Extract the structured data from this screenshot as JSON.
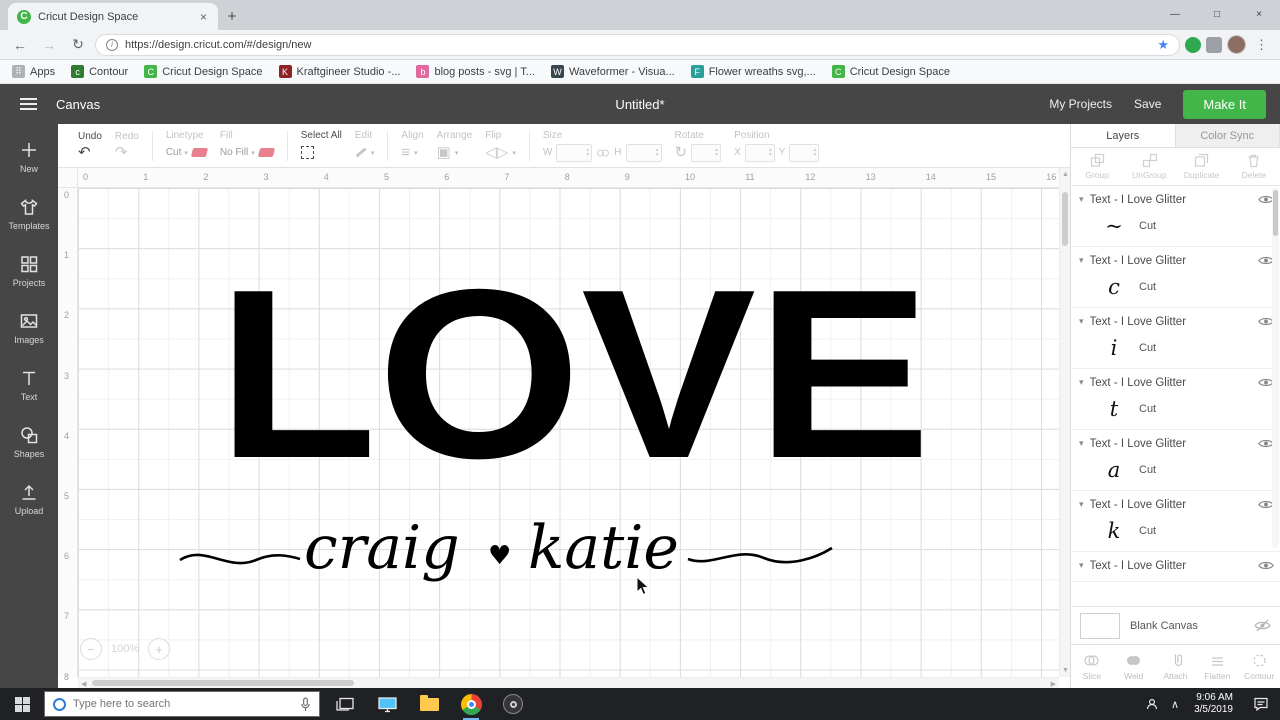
{
  "colors": {
    "accent_green": "#43b649",
    "app_dark": "#464646",
    "swatch_pink": "#e8808d",
    "artwork_black": "#000000"
  },
  "browser": {
    "tab_title": "Cricut Design Space",
    "favicon_letter": "C",
    "close_tab": "×",
    "new_tab": "+",
    "win_min": "—",
    "win_max": "□",
    "win_close": "×",
    "back": "←",
    "forward": "→",
    "reload": "↻",
    "star": "★",
    "menu": "⋮",
    "url": "https://design.cricut.com/#/design/new",
    "bookmarks": [
      {
        "label": "Apps",
        "letter": "⠿",
        "color": "#aeb1b6"
      },
      {
        "label": "Contour",
        "letter": "c",
        "color": "#2e7d32"
      },
      {
        "label": "Cricut Design Space",
        "letter": "C",
        "color": "#43b649"
      },
      {
        "label": "Kraftgineer Studio -...",
        "letter": "K",
        "color": "#8e2323"
      },
      {
        "label": "blog posts - svg | T...",
        "letter": "b",
        "color": "#e06a9f"
      },
      {
        "label": "Waveformer - Visua...",
        "letter": "W",
        "color": "#37474f"
      },
      {
        "label": "Flower wreaths svg,...",
        "letter": "F",
        "color": "#2aa198"
      },
      {
        "label": "Cricut Design Space",
        "letter": "C",
        "color": "#43b649"
      }
    ]
  },
  "header": {
    "view": "Canvas",
    "title": "Untitled*",
    "my_projects": "My Projects",
    "save": "Save",
    "make_it": "Make It"
  },
  "toolbar": {
    "undo": "Undo",
    "redo": "Redo",
    "undo_icon": "↶",
    "redo_icon": "↷",
    "linetype_label": "Linetype",
    "linetype_value": "Cut",
    "fill_label": "Fill",
    "fill_value": "No Fill",
    "select_all": "Select All",
    "edit": "Edit",
    "align": "Align",
    "arrange": "Arrange",
    "flip": "Flip",
    "size_label": "Size",
    "w": "W",
    "h": "H",
    "rotate": "Rotate",
    "rotate_icon": "↻",
    "position_label": "Position",
    "x": "X",
    "y": "Y",
    "caret": "▾"
  },
  "sidebar": {
    "items": [
      {
        "label": "New"
      },
      {
        "label": "Templates"
      },
      {
        "label": "Projects"
      },
      {
        "label": "Images"
      },
      {
        "label": "Text"
      },
      {
        "label": "Shapes"
      },
      {
        "label": "Upload"
      }
    ]
  },
  "canvas": {
    "ruler_h": [
      "0",
      "1",
      "2",
      "3",
      "4",
      "5",
      "6",
      "7",
      "8",
      "9",
      "10",
      "11",
      "12",
      "13",
      "14",
      "15",
      "16"
    ],
    "ruler_v": [
      "0",
      "1",
      "2",
      "3",
      "4",
      "5",
      "6",
      "7",
      "8"
    ],
    "zoom_out": "−",
    "zoom_value": "100%",
    "zoom_in": "+",
    "artwork": {
      "word": "LOVE",
      "name_left": "craig",
      "heart": "♥",
      "name_right": "katie"
    }
  },
  "layers_panel": {
    "tabs": {
      "layers": "Layers",
      "color_sync": "Color Sync"
    },
    "actions": {
      "group": "Group",
      "ungroup": "UnGroup",
      "duplicate": "Duplicate",
      "delete": "Delete"
    },
    "chevron": "▾",
    "layers": [
      {
        "title": "Text - I Love Glitter",
        "op": "Cut",
        "glyph": "~"
      },
      {
        "title": "Text - I Love Glitter",
        "op": "Cut",
        "glyph": "c"
      },
      {
        "title": "Text - I Love Glitter",
        "op": "Cut",
        "glyph": "i"
      },
      {
        "title": "Text - I Love Glitter",
        "op": "Cut",
        "glyph": "t"
      },
      {
        "title": "Text - I Love Glitter",
        "op": "Cut",
        "glyph": "a"
      },
      {
        "title": "Text - I Love Glitter",
        "op": "Cut",
        "glyph": "k"
      },
      {
        "title": "Text - I Love Glitter",
        "op": null,
        "glyph": null
      }
    ],
    "blank_canvas": "Blank Canvas",
    "tools": {
      "slice": "Slice",
      "weld": "Weld",
      "attach": "Attach",
      "flatten": "Flatten",
      "contour": "Contour"
    }
  },
  "taskbar": {
    "search_placeholder": "Type here to search",
    "hidden_icons": "∧",
    "time": "9:06 AM",
    "date": "3/5/2019"
  }
}
